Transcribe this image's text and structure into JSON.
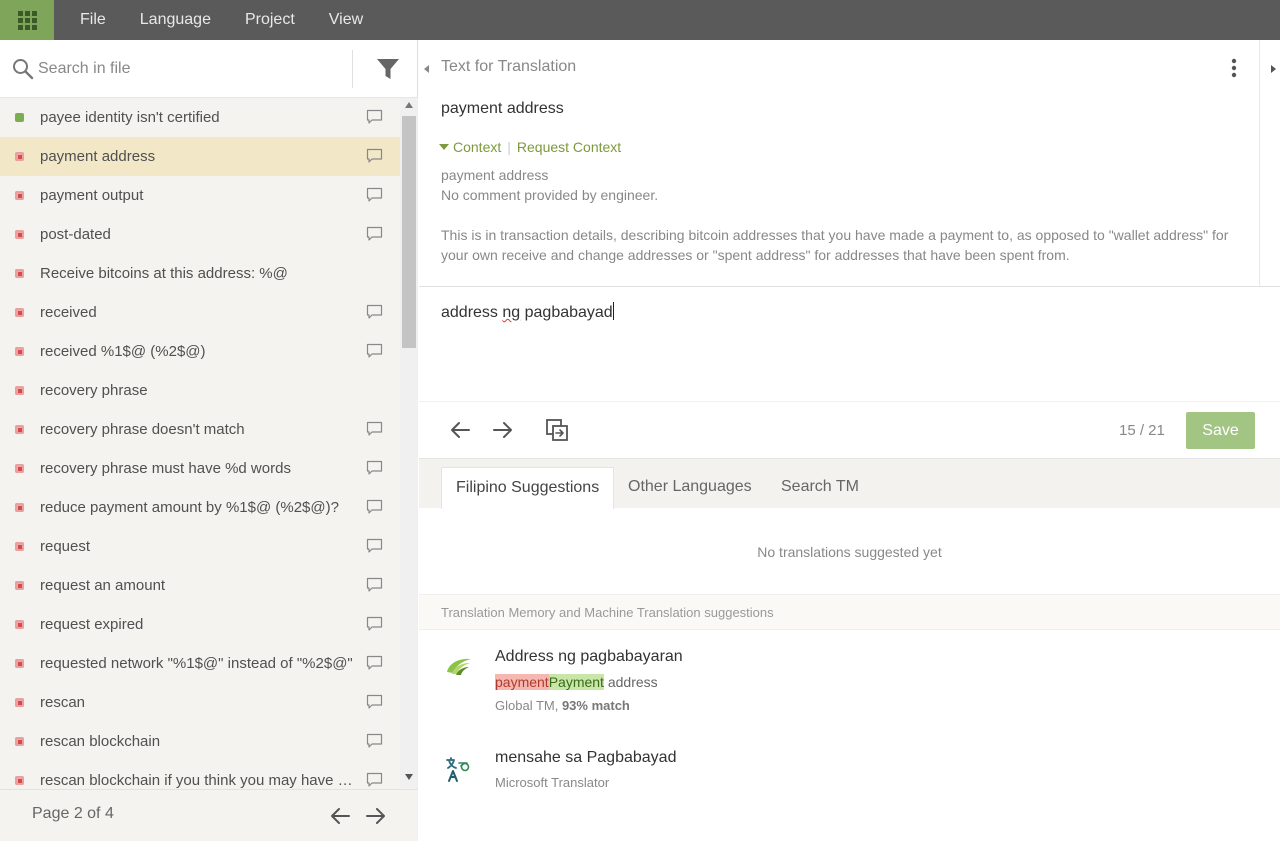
{
  "menu": {
    "items": [
      "File",
      "Language",
      "Project",
      "View"
    ]
  },
  "search": {
    "placeholder": "Search in file"
  },
  "strings": [
    {
      "label": "payee identity isn't certified",
      "status": "green",
      "comment": true
    },
    {
      "label": "payment address",
      "status": "red",
      "comment": true,
      "active": true
    },
    {
      "label": "payment output",
      "status": "red",
      "comment": true
    },
    {
      "label": "post-dated",
      "status": "red",
      "comment": true
    },
    {
      "label": "Receive bitcoins at this address: %@",
      "status": "red",
      "comment": false
    },
    {
      "label": "received",
      "status": "red",
      "comment": true
    },
    {
      "label": "received %1$@ (%2$@)",
      "status": "red",
      "comment": true
    },
    {
      "label": "recovery phrase",
      "status": "red",
      "comment": false
    },
    {
      "label": "recovery phrase doesn't match",
      "status": "red",
      "comment": true
    },
    {
      "label": "recovery phrase must have %d words",
      "status": "red",
      "comment": true
    },
    {
      "label": "reduce payment amount by %1$@ (%2$@)?",
      "status": "red",
      "comment": true
    },
    {
      "label": "request",
      "status": "red",
      "comment": true
    },
    {
      "label": "request an amount",
      "status": "red",
      "comment": true
    },
    {
      "label": "request expired",
      "status": "red",
      "comment": true
    },
    {
      "label": "requested network \"%1$@\" instead of \"%2$@\"",
      "status": "red",
      "comment": true
    },
    {
      "label": "rescan",
      "status": "red",
      "comment": true
    },
    {
      "label": "rescan blockchain",
      "status": "red",
      "comment": true
    },
    {
      "label": "rescan blockchain if you think you may have missing transactions",
      "status": "red",
      "comment": true
    }
  ],
  "pager": {
    "label": "Page 2 of 4"
  },
  "editor": {
    "title": "Text for Translation",
    "source": "payment address",
    "context_label": "Context",
    "request_context_label": "Request Context",
    "context_key": "payment address",
    "context_comment": "No comment provided by engineer.",
    "context_description": "This is in transaction details, describing bitcoin addresses that you have made a payment to, as opposed to \"wallet address\" for your own receive and change addresses or \"spent address\" for addresses that have been spent from.",
    "translation_part1": "address ",
    "translation_misspelled": "ng",
    "translation_part2": " pagbabayad",
    "counter": "15 / 21",
    "save_label": "Save"
  },
  "tabs": [
    {
      "label": "Filipino Suggestions",
      "active": true
    },
    {
      "label": "Other Languages",
      "active": false
    },
    {
      "label": "Search TM",
      "active": false
    }
  ],
  "suggestions": {
    "empty_message": "No translations suggested yet",
    "tm_header": "Translation Memory and Machine Translation suggestions",
    "items": [
      {
        "text": "Address ng pagbabayaran",
        "src_deleted": "payment",
        "src_inserted": "Payment",
        "src_rest": " address",
        "source_name": "Global TM, ",
        "match": "93% match",
        "logo": "global-tm-icon"
      },
      {
        "text": "mensahe sa Pagbabayad",
        "source_name": "Microsoft Translator",
        "logo": "microsoft-translator-icon"
      }
    ]
  },
  "colors": {
    "accent_green": "#7ea55a",
    "menubar": "#5a5a5a",
    "active_row": "#f2e8c8",
    "save_button": "#a3c584",
    "untranslated_red": "#d84a4a"
  }
}
